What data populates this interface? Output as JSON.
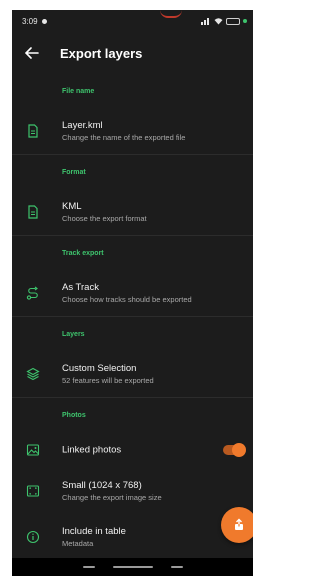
{
  "status_bar": {
    "time": "3:09"
  },
  "app_bar": {
    "title": "Export layers"
  },
  "sections": {
    "file_name": {
      "header": "File name",
      "primary": "Layer.kml",
      "secondary": "Change the name of the exported file"
    },
    "format": {
      "header": "Format",
      "primary": "KML",
      "secondary": "Choose the export format"
    },
    "track_export": {
      "header": "Track export",
      "primary": "As Track",
      "secondary": "Choose how tracks should be exported"
    },
    "layers": {
      "header": "Layers",
      "primary": "Custom Selection",
      "secondary": "52 features will be exported"
    },
    "photos": {
      "header": "Photos",
      "linked_photos": {
        "primary": "Linked photos",
        "toggle_on": true
      },
      "image_size": {
        "primary": "Small (1024 x 768)",
        "secondary": "Change the export image size"
      },
      "include_in_table": {
        "primary": "Include in table",
        "secondary": "Metadata"
      }
    }
  },
  "colors": {
    "background": "#1c1c1c",
    "accent_green": "#3ec46d",
    "accent_orange": "#f07a2c",
    "text_primary": "#f2f2f2",
    "text_secondary": "#a9a9a9"
  },
  "icons": {
    "back": "arrow-left-icon",
    "file": "document-icon",
    "format": "document-icon",
    "track": "route-icon",
    "layers": "layers-icon",
    "photos": "image-icon",
    "size": "crop-icon",
    "info": "info-icon",
    "fab": "export-icon"
  }
}
